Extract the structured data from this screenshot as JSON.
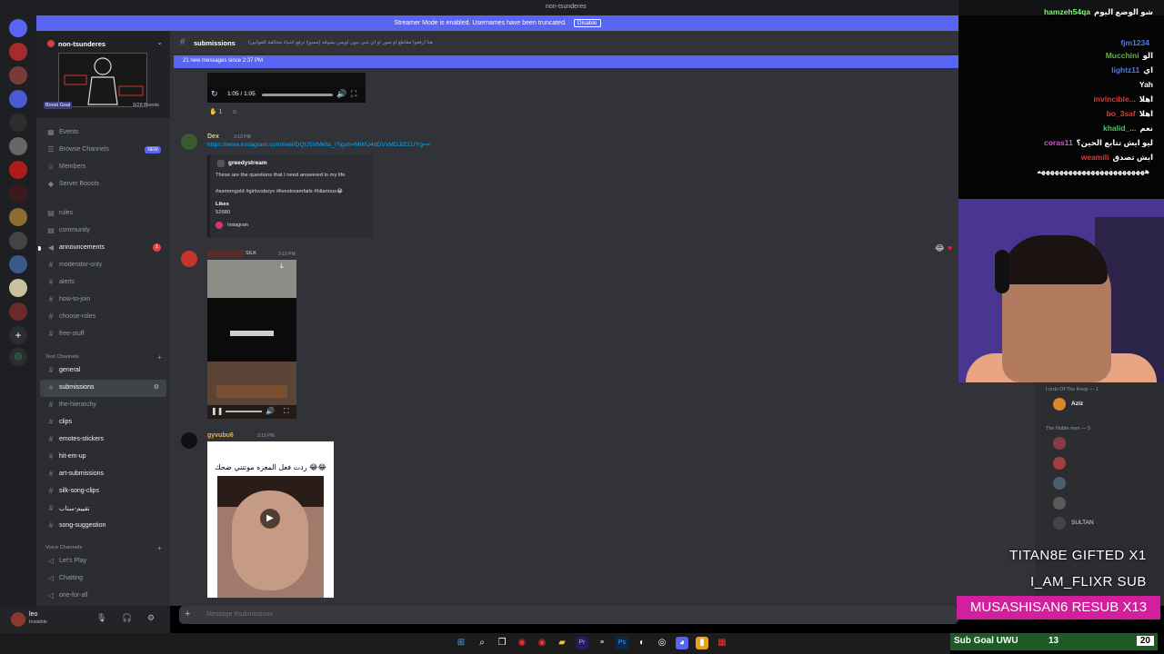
{
  "window": {
    "title": "non-tsunderes"
  },
  "streamer_mode": {
    "text": "Streamer Mode is enabled. Usernames have been truncated.",
    "disable_label": "Disable"
  },
  "server": {
    "name": "non-tsunderes",
    "boost_label": "Boost Goal",
    "boost_count": "9/28 Boosts"
  },
  "nav_top": [
    {
      "label": "Events"
    },
    {
      "label": "Browse Channels",
      "badge": "NEW"
    },
    {
      "label": "Members"
    },
    {
      "label": "Server Boosts"
    }
  ],
  "channels_top": [
    {
      "label": "rules"
    },
    {
      "label": "community"
    },
    {
      "label": "announcements",
      "badge": "1"
    },
    {
      "label": "moderator-only"
    },
    {
      "label": "alerts"
    },
    {
      "label": "how-to-join"
    },
    {
      "label": "choose-roles"
    },
    {
      "label": "free-stuff"
    }
  ],
  "text_category": "Text Channels",
  "text_channels": [
    {
      "label": "general"
    },
    {
      "label": "submissions"
    },
    {
      "label": "the-hierarchy"
    },
    {
      "label": "clips"
    },
    {
      "label": "emotes-stickers"
    },
    {
      "label": "hit-em-up"
    },
    {
      "label": "art-submissions"
    },
    {
      "label": "silk-song-clips"
    },
    {
      "label": "تقييم-ستاب"
    },
    {
      "label": "song-suggestion"
    }
  ],
  "voice_category": "Voice Channels",
  "voice_channels": [
    {
      "label": "Let's Play"
    },
    {
      "label": "Chatting"
    },
    {
      "label": "one-for-all"
    }
  ],
  "user": {
    "name": "leo",
    "status": "Invisible"
  },
  "chat": {
    "channel": "submissions",
    "topic": "هنا ارفعوا مقاطع او صور او اي شي تبون لويس يشوفه (ممنوع ترفع اشياء مخالفة للقوانين)",
    "new_messages": "21 new messages since 2:37 PM",
    "player_time": "1:05 / 1:05",
    "reaction_count": "1",
    "composer_placeholder": "Message #submissions"
  },
  "messages": [
    {
      "author": "Dex",
      "time": "3:13 PM",
      "color": "#c9d66d",
      "link": "https://www.instagram.com/reel/DQfJ5VMkIw_/?igsh=MWU4dDVxMDJiZ21rYg==",
      "embed": {
        "author": "greedystream",
        "description": "These are the questions that I need answered in my life.",
        "tags": "#asmongold #girlsvsboys #livestreamfails #hilarious😂",
        "field_label": "Likes",
        "field_value": "52680",
        "footer": "Instagram"
      }
    },
    {
      "author": "",
      "role": "SILK",
      "time": "3:15 PM",
      "color": "#e03b3b"
    },
    {
      "author": "gyvubu6",
      "time": "3:15 PM",
      "color": "#f0b232",
      "caption": "ردت فعل المعزه موتتني ضحك 😂😂"
    }
  ],
  "stream_chat": [
    {
      "user": "hamzeh54qa",
      "text": "شو الوضع اليوم",
      "color": "#8bf57f"
    },
    {
      "user": "fjm1234",
      "text": "",
      "color": "#4e7fe0"
    },
    {
      "user": "Mucchini",
      "text": "الو",
      "color": "#6ab04c"
    },
    {
      "user": "lightz11",
      "text": "اي",
      "color": "#4e7fe0"
    },
    {
      "user": "",
      "text": "Yah",
      "color": "#4e7fe0"
    },
    {
      "user": "invincible...",
      "text": "اهلا",
      "color": "#e03b3b"
    },
    {
      "user": "bo_3saf",
      "text": "اهلا",
      "color": "#e03b3b"
    },
    {
      "user": "khalid_...",
      "text": "نعم",
      "color": "#57c26a"
    },
    {
      "user": "coras11",
      "text": "ليو ايش تتابع الحين؟",
      "color": "#cf5bd9"
    },
    {
      "user": "weamili",
      "text": "ايش تصدق",
      "color": "#e03b3b"
    },
    {
      "user": "",
      "text": "ههههههههههههههههههههههههه",
      "color": "#ffffff"
    }
  ],
  "member_list": {
    "cat1": "Lords Of The Keep — 1",
    "row1": "Aziz",
    "cat2": "The Noble men — 5",
    "row2": "SULTAN"
  },
  "overlay": {
    "gift_line": "TITAN8E  GIFTED X1",
    "sub_line": "I_AM_FLIXR  SUB",
    "resub_line": "MUSASHISAN6  RESUB X13",
    "sub_goal_label": "Sub Goal UWU",
    "sub_goal_current": "13",
    "sub_goal_target": "20"
  },
  "colors": {
    "blurple": "#5865f2",
    "sidebar": "#2b2d31",
    "chat_bg": "#313338",
    "resub": "#d11f9d",
    "sub_goal": "#1d5a26"
  }
}
